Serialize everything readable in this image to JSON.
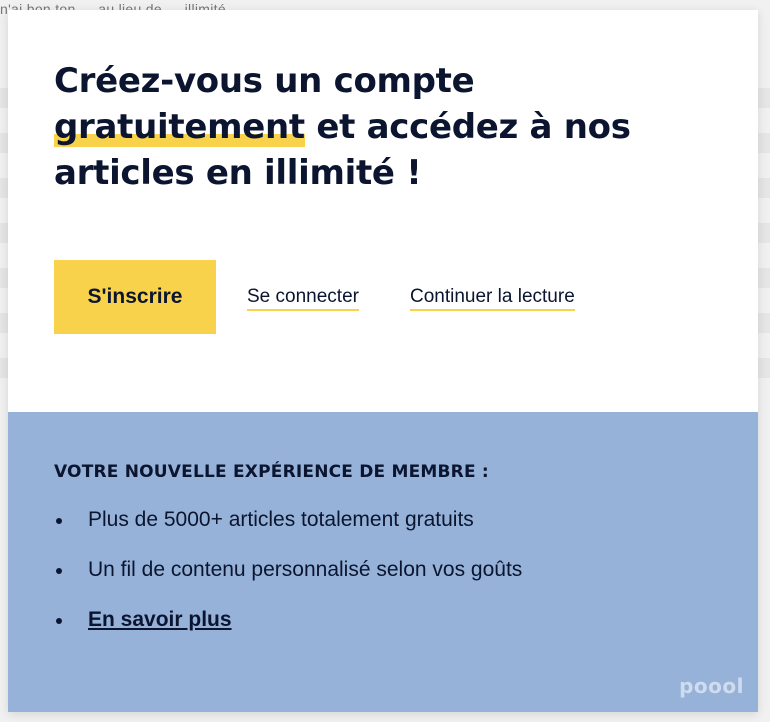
{
  "background": {
    "snippet": "n'ai bon ton … au lieu de … illimité ..."
  },
  "modal": {
    "headline": {
      "part1": "Créez-vous un compte ",
      "highlight": "gratuitement",
      "part2": " et accédez à nos articles en illimité !"
    },
    "actions": {
      "signup_label": "S'inscrire",
      "login_label": "Se connecter",
      "continue_label": "Continuer la lecture"
    },
    "member": {
      "title": "VOTRE NOUVELLE EXPÉRIENCE DE MEMBRE :",
      "benefits": [
        "Plus de 5000+ articles totalement gratuits",
        "Un fil de contenu personnalisé selon vos goûts"
      ],
      "learn_more": "En savoir plus"
    },
    "logo_text": "poool"
  },
  "colors": {
    "accent": "#f8d24b",
    "panel": "#96b2d9",
    "text": "#0b1530"
  }
}
